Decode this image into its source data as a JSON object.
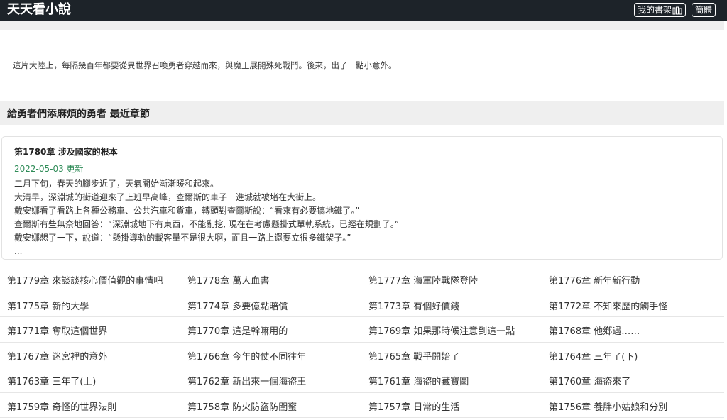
{
  "header": {
    "site_title": "天天看小說",
    "shelf_button": "我的書架",
    "lang_button": "簡體"
  },
  "intro": "這片大陸上，每隔幾百年都要從異世界召喚勇者穿越而來，與魔王展開殊死戰鬥。後來，出了一點小意外。",
  "section": {
    "title": "給勇者們添麻煩的勇者 最近章節"
  },
  "latest": {
    "title": "第1780章 涉及國家的根本",
    "date": "2022-05-03 更新",
    "excerpt": [
      "二月下旬，春天的腳步近了，天氣開始漸漸暖和起來。",
      "大清早，深淵城的街道迎來了上班早高峰，查爾斯的車子一進城就被堵在大街上。",
      "戴安娜看了看路上各種公務車、公共汽車和貨車，轉頭對查爾斯說：“看來有必要搞地鐵了。”",
      "查爾斯有些無奈地回答：“深淵城地下有東西，不能亂挖, 現在在考慮懸掛式單軌系統，已經在規劃了。”",
      "戴安娜想了一下，說道：“懸掛導軌的載客量不是很大啊，而且一路上還要立很多鐵架子。”",
      "..."
    ]
  },
  "chapters": [
    [
      "第1779章 來談談核心價值觀的事情吧",
      "第1778章 萬人血書",
      "第1777章 海軍陸戰隊登陸",
      "第1776章 新年新行動"
    ],
    [
      "第1775章 新的大學",
      "第1774章 多要億點賠償",
      "第1773章 有個好價錢",
      "第1772章 不知來歷的觸手怪"
    ],
    [
      "第1771章 奪取這個世界",
      "第1770章 這是幹嘛用的",
      "第1769章 如果那時候注意到這一點",
      "第1768章 他鄉遇……"
    ],
    [
      "第1767章 迷宮裡的意外",
      "第1766章 今年的仗不同往年",
      "第1765章 戰爭開始了",
      "第1764章 三年了(下)"
    ],
    [
      "第1763章 三年了(上)",
      "第1762章 新出來一個海盜王",
      "第1761章 海盜的藏寶圖",
      "第1760章 海盜來了"
    ],
    [
      "第1759章 奇怪的世界法則",
      "第1758章 防火防盜防閨蜜",
      "第1757章 日常的生活",
      "第1756章 養胖小姑娘和分別"
    ]
  ]
}
